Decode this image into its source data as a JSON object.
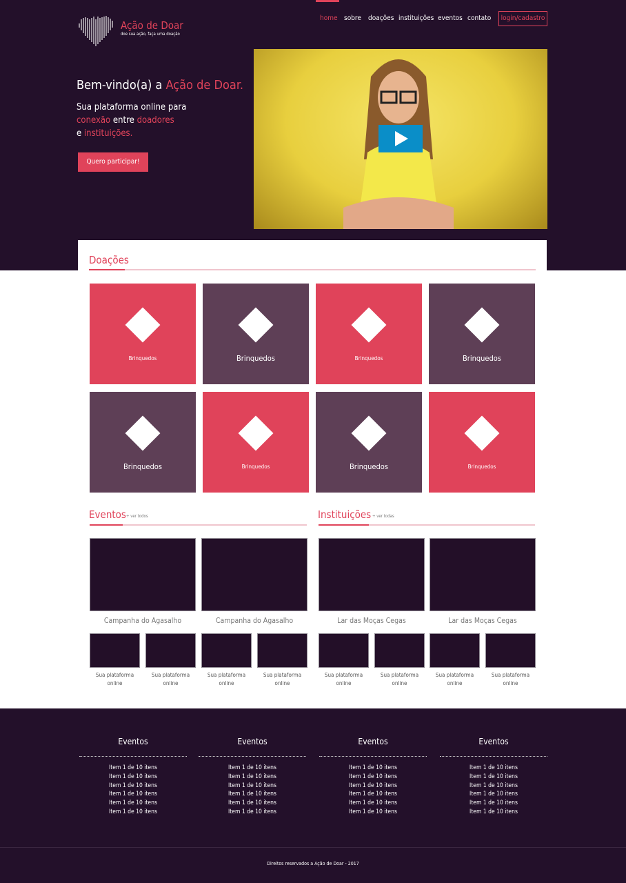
{
  "brand": {
    "name": "Ação de Doar",
    "tagline": "doe sua ação, faça uma doação"
  },
  "nav": {
    "items": [
      "home",
      "sobre",
      "doações",
      "instituições",
      "eventos",
      "contato"
    ],
    "active": "home",
    "login": "login/cadastro"
  },
  "hero": {
    "title_prefix": "Bem-vindo(a) a ",
    "title_accent": "Ação de Doar.",
    "line1": "Sua plataforma online para",
    "line2_accent": "conexão",
    "line2_rest": " entre ",
    "line2_accent2": "doadores",
    "line3_prefix": "e ",
    "line3_accent": "instituições.",
    "cta": "Quero participar!"
  },
  "doacoes": {
    "title": "Doações",
    "tiles": [
      {
        "label": "Brinquedos",
        "color": "pink"
      },
      {
        "label": "Brinquedos",
        "color": "purple"
      },
      {
        "label": "Brinquedos",
        "color": "pink"
      },
      {
        "label": "Brinquedos",
        "color": "purple"
      },
      {
        "label": "Brinquedos",
        "color": "purple"
      },
      {
        "label": "Brinquedos",
        "color": "pink"
      },
      {
        "label": "Brinquedos",
        "color": "purple"
      },
      {
        "label": "Brinquedos",
        "color": "pink"
      }
    ]
  },
  "eventos": {
    "title": "Eventos",
    "more": "+ ver todos",
    "featured": [
      "Campanha do Agasalho",
      "Campanha do Agasalho"
    ],
    "small": [
      "Sua plataforma online",
      "Sua plataforma online",
      "Sua plataforma online",
      "Sua plataforma online"
    ]
  },
  "instituicoes": {
    "title": "Instituições",
    "more": "+ ver todas",
    "featured": [
      "Lar das Moças Cegas",
      "Lar das Moças Cegas"
    ],
    "small": [
      "Sua plataforma online",
      "Sua plataforma online",
      "Sua plataforma online",
      "Sua plataforma online"
    ]
  },
  "footer": {
    "columns": [
      {
        "title": "Eventos",
        "items": [
          "Item 1 de 10 itens",
          "Item 1 de 10 itens",
          "Item 1 de 10 itens",
          "Item 1 de 10 itens",
          "Item 1 de 10 itens",
          "Item 1 de 10 itens"
        ]
      },
      {
        "title": "Eventos",
        "items": [
          "Item 1 de 10 itens",
          "Item 1 de 10 itens",
          "Item 1 de 10 itens",
          "Item 1 de 10 itens",
          "Item 1 de 10 itens",
          "Item 1 de 10 itens"
        ]
      },
      {
        "title": "Eventos",
        "items": [
          "Item 1 de 10 itens",
          "Item 1 de 10 itens",
          "Item 1 de 10 itens",
          "Item 1 de 10 itens",
          "Item 1 de 10 itens",
          "Item 1 de 10 itens"
        ]
      },
      {
        "title": "Eventos",
        "items": [
          "Item 1 de 10 itens",
          "Item 1 de 10 itens",
          "Item 1 de 10 itens",
          "Item 1 de 10 itens",
          "Item 1 de 10 itens",
          "Item 1 de 10 itens"
        ]
      }
    ],
    "copyright": "Direitos reservados a Ação de Doar - 2017"
  },
  "colors": {
    "accent": "#e0435a",
    "dark": "#23102a",
    "purple": "#5e3f56",
    "play": "#0a8ec8"
  }
}
